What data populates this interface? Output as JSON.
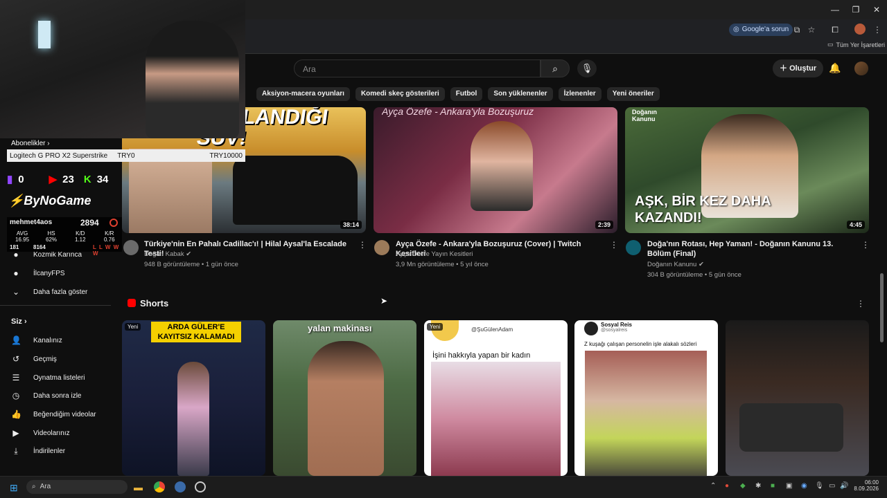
{
  "browser": {
    "google_button": "Google'a sorun",
    "all_bookmarks": "Tüm Yer İşaretleri"
  },
  "header": {
    "search_placeholder": "Ara",
    "create_label": "Oluştur"
  },
  "chips": [
    "Aksiyon-macera oyunları",
    "Komedi skeç gösterileri",
    "Futbol",
    "Son yüklenenler",
    "İzlenenler",
    "Yeni öneriler"
  ],
  "videos": [
    {
      "overlay_text": "KULLANDIĞI SUV!",
      "duration": "38:14",
      "title": "Türkiye'nin En Pahalı Cadillac'ı! | Hilal Aysal'la Escalade Testi!",
      "channel": "Doğan Kabak",
      "meta": "948 B görüntüleme • 1 gün önce"
    },
    {
      "overlay_text": "Ayça Özefe - Ankara'yla Bozuşuruz",
      "duration": "2:39",
      "title": "Ayça Özefe - Ankara'yla Bozuşuruz (Cover) | Twitch Kesitleri",
      "channel": "Ayça Özefe Yayın Kesitleri",
      "meta": "3,9 Mn görüntüleme • 5 yıl önce"
    },
    {
      "overlay_text": "AŞK, BİR KEZ DAHA KAZANDI!",
      "brand_text": "Doğanın Kanunu",
      "duration": "4:45",
      "title": "Doğa'nın Rotası, Hep Yaman! - Doğanın Kanunu 13. Bölüm (Final)",
      "channel": "Doğanın Kanunu",
      "meta": "304 B görüntüleme • 5 gün önce"
    }
  ],
  "shorts": {
    "heading": "Shorts",
    "items": [
      {
        "badge": "Yeni",
        "text": "ARDA GÜLER'E KAYITSIZ KALAMADI"
      },
      {
        "badge": "",
        "text": "yalan makinası"
      },
      {
        "badge": "Yeni",
        "handle": "@ŞuGülenAdam",
        "text": "İşini hakkıyla yapan bir kadın"
      },
      {
        "badge": "",
        "account": "Sosyal Reis",
        "handle": "@sosyalreis",
        "text": "Z kuşağı çalışan personelin işle alakalı sözleri"
      },
      {
        "badge": "",
        "text": ""
      }
    ]
  },
  "sidebar": {
    "subscriptions_label": "Abonelikler",
    "sub_items": [
      "Kozmik Karınca",
      "İlcanyFPS"
    ],
    "show_more": "Daha fazla göster",
    "you_label": "Siz",
    "items": [
      "Kanalınız",
      "Geçmiş",
      "Oynatma listeleri",
      "Daha sonra izle",
      "Beğendiğim videolar",
      "Videolarınız",
      "İndirilenler"
    ]
  },
  "stream_overlay": {
    "product": "Logitech G PRO X2 Superstrike",
    "goal_start": "TRY0",
    "goal_end": "TRY10000",
    "twitch_count": "0",
    "youtube_count": "23",
    "kick_count": "34",
    "brand": "ByNoGame",
    "player": "mehmet4aos",
    "elo": "2894",
    "stats": {
      "avg_label": "AVG",
      "avg": "16.95",
      "hs_label": "HS",
      "hs": "62%",
      "kd_label": "K/D",
      "kd": "1.12",
      "kr_label": "K/R",
      "kr": "0.76",
      "left1": "181",
      "left2": "8164"
    }
  },
  "taskbar": {
    "search": "Ara",
    "time": "06:00",
    "date": "8.09.2026"
  },
  "colors": {
    "background": "#0f0f0f",
    "chip": "#272727",
    "shorts_red": "#ff0000",
    "accent_blue": "#3ea6ff"
  }
}
